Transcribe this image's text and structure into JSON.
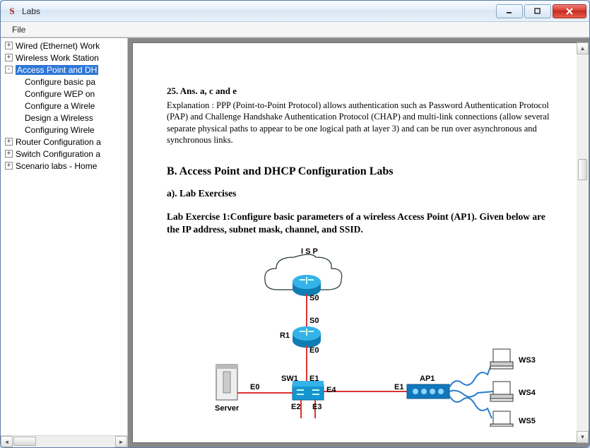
{
  "window": {
    "title": "Labs"
  },
  "menu": {
    "file": "File"
  },
  "tree": {
    "items": [
      {
        "expander": "+",
        "label": "Wired (Ethernet) Work"
      },
      {
        "expander": "+",
        "label": "Wireless Work Station"
      },
      {
        "expander": "-",
        "label": "Access Point and DH",
        "selected": true
      },
      {
        "indent": true,
        "label": "Configure basic pa"
      },
      {
        "indent": true,
        "label": "Configure WEP on"
      },
      {
        "indent": true,
        "label": "Configure a Wirele"
      },
      {
        "indent": true,
        "label": "Design a Wireless"
      },
      {
        "indent": true,
        "label": "Configuring Wirele"
      },
      {
        "expander": "+",
        "label": "Router Configuration a"
      },
      {
        "expander": "+",
        "label": "Switch Configuration a"
      },
      {
        "expander": "+",
        "label": "Scenario labs - Home"
      }
    ]
  },
  "doc": {
    "ans_head": "25. Ans. a, c and e",
    "ans_body": "Explanation : PPP (Point-to-Point Protocol) allows authentication such as Password Authentication Protocol (PAP) and Challenge Handshake Authentication Protocol (CHAP) and multi-link connections (allow several separate physical paths to appear to be one logical path at layer 3) and can be run over asynchronous and synchronous links.",
    "section": "B. Access Point and DHCP Configuration Labs",
    "sub": "a). Lab Exercises",
    "exercise": "Lab Exercise 1:Configure basic parameters of a wireless Access Point (AP1). Given below are the IP address, subnet mask, channel, and SSID."
  },
  "diagram": {
    "labels": {
      "isp": "I S P",
      "s0a": "S0",
      "s0b": "S0",
      "r1": "R1",
      "e0a": "E0",
      "sw1": "SW1",
      "e1a": "E1",
      "e4": "E4",
      "e1b": "E1",
      "ap1": "AP1",
      "server": "Server",
      "e0b": "E0",
      "e2": "E2",
      "e3": "E3",
      "ws3": "WS3",
      "ws4": "WS4",
      "ws5": "WS5"
    }
  }
}
